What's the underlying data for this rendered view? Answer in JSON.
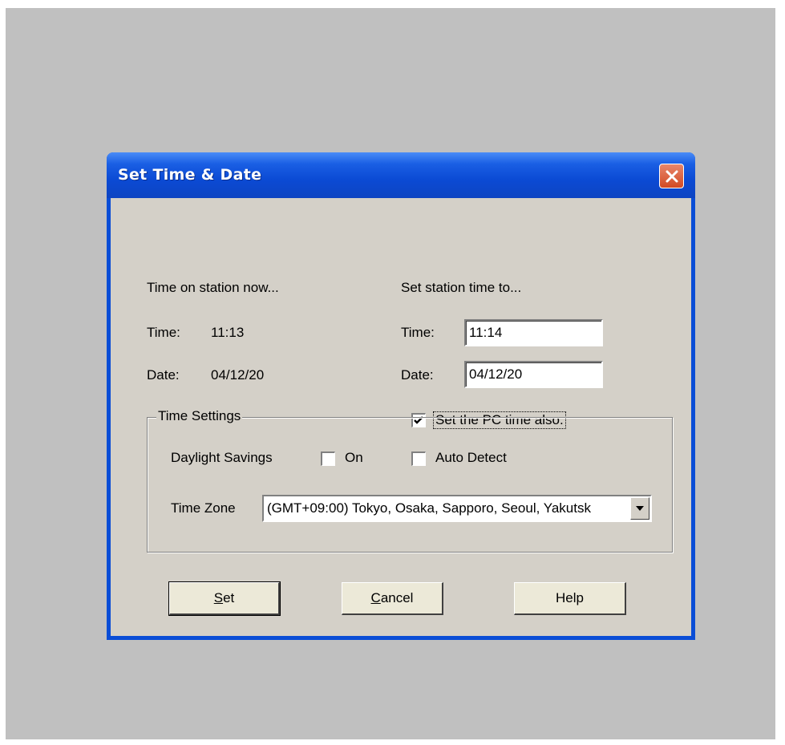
{
  "dialog": {
    "title": "Set Time & Date"
  },
  "current": {
    "heading": "Time on station now...",
    "time_label": "Time:",
    "time_value": "11:13",
    "date_label": "Date:",
    "date_value": "04/12/20"
  },
  "set": {
    "heading": "Set station time to...",
    "time_label": "Time:",
    "time_value": "11:14",
    "date_label": "Date:",
    "date_value": "04/12/20",
    "pc_time_label": "Set the PC time also.",
    "pc_time_checked": true
  },
  "time_settings": {
    "legend": "Time Settings",
    "daylight_label": "Daylight Savings",
    "on_label": "On",
    "on_checked": false,
    "auto_detect_label": "Auto Detect",
    "auto_detect_checked": false,
    "time_zone_label": "Time Zone",
    "time_zone_value": "(GMT+09:00) Tokyo, Osaka, Sapporo, Seoul, Yakutsk"
  },
  "buttons": {
    "set_rest": "et",
    "set_mnemonic": "S",
    "cancel_rest": "ancel",
    "cancel_mnemonic": "C",
    "help": "Help"
  },
  "colors": {
    "titlebar": "#0a4dd6",
    "client_bg": "#d4d0c8",
    "close_button": "#d24a24"
  },
  "icons": {
    "close": "close-icon",
    "dropdown": "chevron-down-icon",
    "check": "checkmark-icon"
  }
}
